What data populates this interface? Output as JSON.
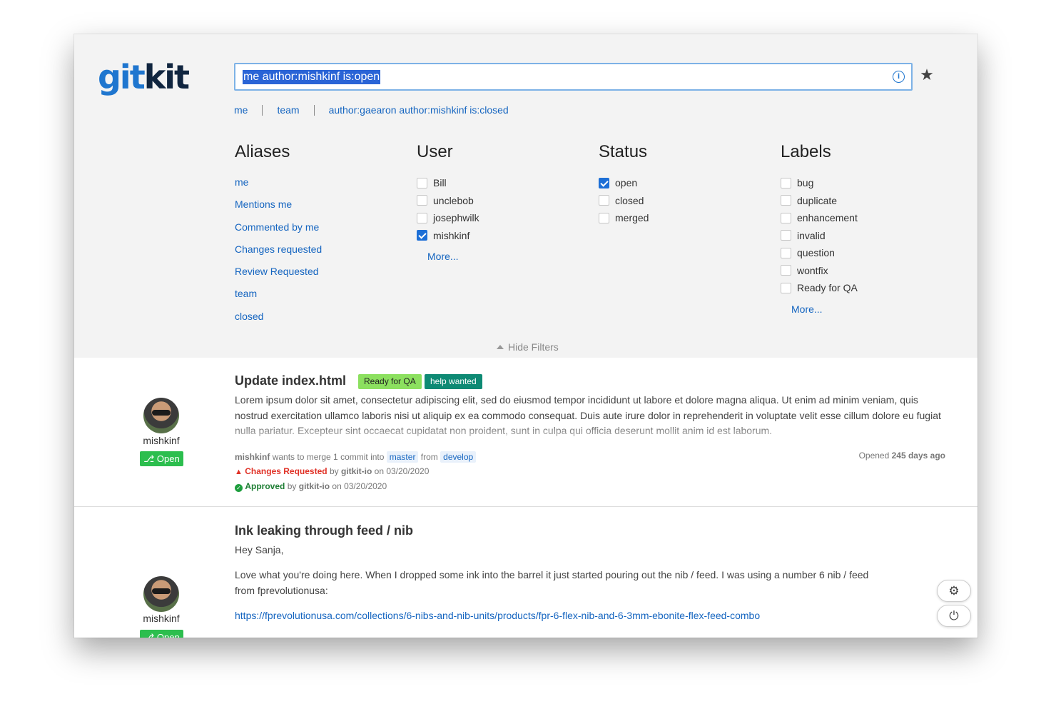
{
  "logo": {
    "part1": "git",
    "part2": "kit"
  },
  "search": {
    "value": "me author:mishkinf is:open"
  },
  "quick_links": [
    "me",
    "team",
    "author:gaearon author:mishkinf is:closed"
  ],
  "filters": {
    "aliases": {
      "title": "Aliases",
      "items": [
        "me",
        "Mentions me",
        "Commented by me",
        "Changes requested",
        "Review Requested",
        "team",
        "closed"
      ]
    },
    "user": {
      "title": "User",
      "items": [
        {
          "label": "Bill",
          "checked": false
        },
        {
          "label": "unclebob",
          "checked": false
        },
        {
          "label": "josephwilk",
          "checked": false
        },
        {
          "label": "mishkinf",
          "checked": true
        }
      ],
      "more": "More..."
    },
    "status": {
      "title": "Status",
      "items": [
        {
          "label": "open",
          "checked": true
        },
        {
          "label": "closed",
          "checked": false
        },
        {
          "label": "merged",
          "checked": false
        }
      ]
    },
    "labels": {
      "title": "Labels",
      "items": [
        {
          "label": "bug",
          "checked": false
        },
        {
          "label": "duplicate",
          "checked": false
        },
        {
          "label": "enhancement",
          "checked": false
        },
        {
          "label": "invalid",
          "checked": false
        },
        {
          "label": "question",
          "checked": false
        },
        {
          "label": "wontfix",
          "checked": false
        },
        {
          "label": "Ready for QA",
          "checked": false
        }
      ],
      "more": "More..."
    },
    "hide_label": "Hide Filters"
  },
  "pull_requests": [
    {
      "title": "Update index.html",
      "labels": [
        {
          "text": "Ready for QA",
          "color": "#8ce05f"
        },
        {
          "text": "help wanted",
          "color": "#0e8a74"
        }
      ],
      "body": "Lorem ipsum dolor sit amet, consectetur adipiscing elit, sed do eiusmod tempor incididunt ut labore et dolore magna aliqua. Ut enim ad minim veniam, quis nostrud exercitation ullamco laboris nisi ut aliquip ex ea commodo consequat. Duis aute irure dolor in reprehenderit in voluptate velit esse cillum dolore eu fugiat nulla pariatur. Excepteur sint occaecat cupidatat non proident, sunt in culpa qui officia deserunt mollit anim id est laborum.",
      "author": "mishkinf",
      "state": "Open",
      "merge_text_1": "wants to merge 1 commit into",
      "base_branch": "master",
      "merge_text_2": "from",
      "head_branch": "develop",
      "review1": {
        "status": "Changes Requested",
        "by_text": "by",
        "reviewer": "gitkit-io",
        "on_text": "on 03/20/2020"
      },
      "review2": {
        "status": "Approved",
        "by_text": "by",
        "reviewer": "gitkit-io",
        "on_text": "on 03/20/2020"
      },
      "opened_prefix": "Opened",
      "opened_age": "245 days ago"
    },
    {
      "title": "Ink leaking through feed / nib",
      "author": "mishkinf",
      "state": "Open",
      "greeting": "Hey Sanja,",
      "paragraph": "Love what you're doing here. When I dropped some ink into the barrel it just started pouring out the nib / feed. I was using a number 6 nib / feed from fprevolutionusa:",
      "link": "https://fprevolutionusa.com/collections/6-nibs-and-nib-units/products/fpr-6-flex-nib-and-6-3mm-ebonite-flex-feed-combo"
    }
  ],
  "colors": {
    "accent": "#1565c0",
    "open": "#2cbe4e",
    "changes_requested": "#e03126",
    "approved": "#1e7e34"
  }
}
